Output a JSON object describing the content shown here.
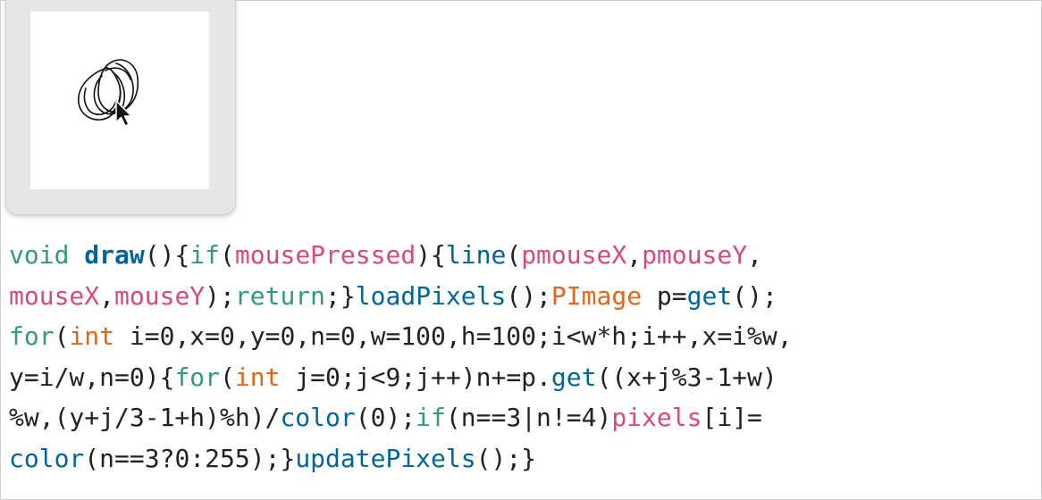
{
  "sketch_window": {
    "drawing": "hand-drawn-circles",
    "cursor": "arrow-cursor"
  },
  "colors": {
    "keyword": "#33997e",
    "type": "#e2661a",
    "function_def": "#006699",
    "builtin_var": "#d94a7a",
    "plain": "#222222",
    "background": "#ffffff",
    "window_bg": "#e6e6e6"
  },
  "code": {
    "lines": [
      [
        {
          "t": "void",
          "k": "keyword"
        },
        {
          "t": " ",
          "k": "plain"
        },
        {
          "t": "draw",
          "k": "function_def",
          "bold": true
        },
        {
          "t": "(){",
          "k": "plain"
        },
        {
          "t": "if",
          "k": "type_green"
        },
        {
          "t": "(",
          "k": "plain"
        },
        {
          "t": "mousePressed",
          "k": "builtin_var"
        },
        {
          "t": "){",
          "k": "plain"
        },
        {
          "t": "line",
          "k": "function_def"
        },
        {
          "t": "(",
          "k": "plain"
        },
        {
          "t": "pmouseX",
          "k": "builtin_var"
        },
        {
          "t": ",",
          "k": "plain"
        },
        {
          "t": "pmouseY",
          "k": "builtin_var"
        },
        {
          "t": ",",
          "k": "plain"
        }
      ],
      [
        {
          "t": "mouseX",
          "k": "builtin_var"
        },
        {
          "t": ",",
          "k": "plain"
        },
        {
          "t": "mouseY",
          "k": "builtin_var"
        },
        {
          "t": ");",
          "k": "plain"
        },
        {
          "t": "return",
          "k": "keyword"
        },
        {
          "t": ";}",
          "k": "plain"
        },
        {
          "t": "loadPixels",
          "k": "function_def"
        },
        {
          "t": "();",
          "k": "plain"
        },
        {
          "t": "PImage",
          "k": "type"
        },
        {
          "t": " p=",
          "k": "plain"
        },
        {
          "t": "get",
          "k": "function_def"
        },
        {
          "t": "();",
          "k": "plain"
        }
      ],
      [
        {
          "t": "for",
          "k": "type_green"
        },
        {
          "t": "(",
          "k": "plain"
        },
        {
          "t": "int",
          "k": "type"
        },
        {
          "t": " i=0,x=0,y=0,n=0,w=100,h=100;i<w*h;i++,x=i%w,",
          "k": "plain"
        }
      ],
      [
        {
          "t": "y=i/w,n=0){",
          "k": "plain"
        },
        {
          "t": "for",
          "k": "type_green"
        },
        {
          "t": "(",
          "k": "plain"
        },
        {
          "t": "int",
          "k": "type"
        },
        {
          "t": " j=0;j<9;j++)n+=p.",
          "k": "plain"
        },
        {
          "t": "get",
          "k": "function_def"
        },
        {
          "t": "((x+j%3-1+w)",
          "k": "plain"
        }
      ],
      [
        {
          "t": "%w,(y+j/3-1+h)%h)/",
          "k": "plain"
        },
        {
          "t": "color",
          "k": "function_def"
        },
        {
          "t": "(0);",
          "k": "plain"
        },
        {
          "t": "if",
          "k": "type_green"
        },
        {
          "t": "(n==3|n!=4)",
          "k": "plain"
        },
        {
          "t": "pixels",
          "k": "builtin_var"
        },
        {
          "t": "[i]=",
          "k": "plain"
        }
      ],
      [
        {
          "t": "color",
          "k": "function_def"
        },
        {
          "t": "(n==3?0:255);}",
          "k": "plain"
        },
        {
          "t": "updatePixels",
          "k": "function_def"
        },
        {
          "t": "();}",
          "k": "plain"
        }
      ]
    ]
  }
}
